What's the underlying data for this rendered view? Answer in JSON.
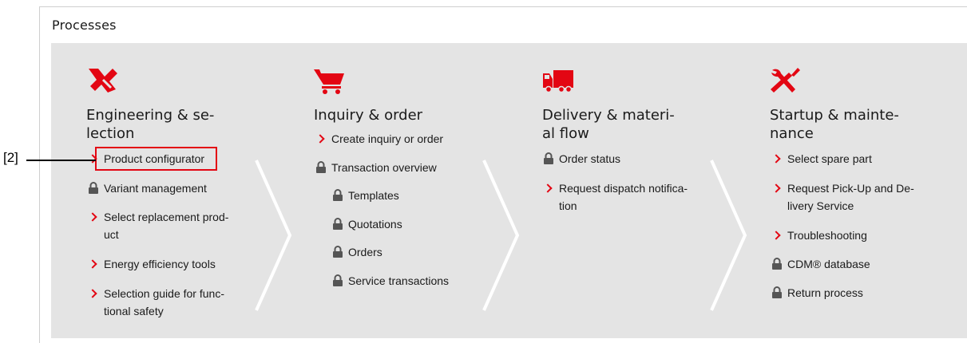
{
  "section": {
    "title": "Processes"
  },
  "callout": {
    "label": "[2]"
  },
  "columns": [
    {
      "icon": "engineering-icon",
      "title": "Engineering & se-\nlection",
      "items": [
        {
          "type": "link",
          "label": "Product configurator"
        },
        {
          "type": "locked",
          "label": "Variant management"
        },
        {
          "type": "link",
          "label": "Select replacement prod-\nuct"
        },
        {
          "type": "link",
          "label": "Energy efficiency tools"
        },
        {
          "type": "link",
          "label": "Selection guide for func-\ntional safety"
        }
      ]
    },
    {
      "icon": "shopping-cart-icon",
      "title": "Inquiry & order",
      "items": [
        {
          "type": "link",
          "label": "Create inquiry or order"
        },
        {
          "type": "locked",
          "label": "Transaction overview"
        },
        {
          "type": "locked",
          "label": "Templates"
        },
        {
          "type": "locked",
          "label": "Quotations"
        },
        {
          "type": "locked",
          "label": "Orders"
        },
        {
          "type": "locked",
          "label": "Service transactions"
        }
      ]
    },
    {
      "icon": "delivery-truck-icon",
      "title": "Delivery & materi-\nal flow",
      "items": [
        {
          "type": "locked",
          "label": "Order status"
        },
        {
          "type": "link",
          "label": "Request dispatch notifica-\ntion"
        }
      ]
    },
    {
      "icon": "tools-icon",
      "title": "Startup & mainte-\nnance",
      "items": [
        {
          "type": "link",
          "label": "Select spare part"
        },
        {
          "type": "link",
          "label": "Request Pick-Up and De-\nlivery Service"
        },
        {
          "type": "link",
          "label": "Troubleshooting"
        },
        {
          "type": "locked",
          "label": "CDM® database"
        },
        {
          "type": "locked",
          "label": "Return process"
        }
      ]
    }
  ],
  "colors": {
    "accent": "#e30613",
    "panel": "#e4e4e4",
    "lock": "#555555"
  }
}
